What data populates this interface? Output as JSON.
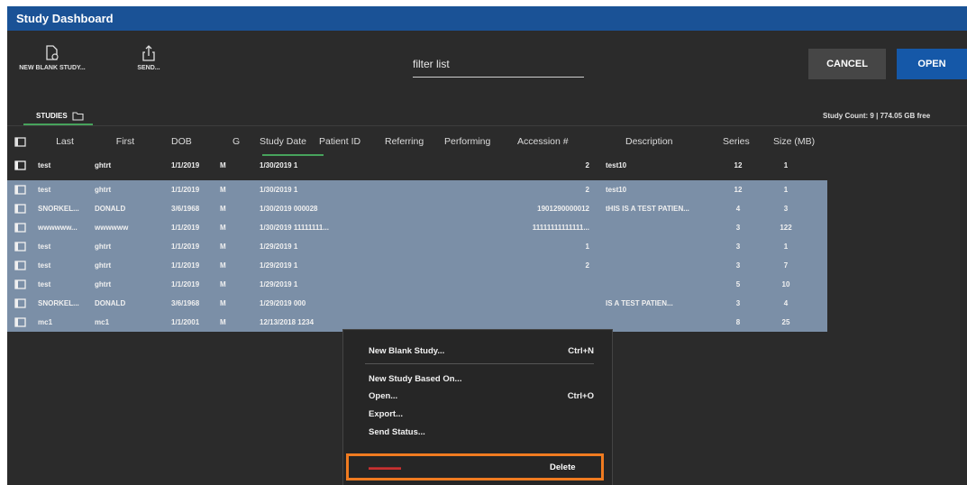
{
  "window": {
    "title": "Study Dashboard"
  },
  "toolbar": {
    "new_blank_study": {
      "label": "NEW BLANK STUDY...",
      "icon": "new-study-icon"
    },
    "send": {
      "label": "SEND...",
      "icon": "share-icon"
    },
    "filter_placeholder": "filter list",
    "cancel_label": "CANCEL",
    "open_label": "OPEN"
  },
  "tabs": {
    "studies_label": "STUDIES"
  },
  "status": {
    "study_count": "Study Count: 9 | 774.05 GB free"
  },
  "table": {
    "columns": [
      "Last",
      "First",
      "DOB",
      "G",
      "Study Date",
      "Patient ID",
      "Referring",
      "Performing",
      "Accession #",
      "Description",
      "Series",
      "Size (MB)"
    ],
    "rows": [
      {
        "last": "test",
        "first": "ghtrt",
        "dob": "1/1/2019",
        "g": "M",
        "date_pid": "1/30/2019  1",
        "acc": "2",
        "desc": "test10",
        "series": "12",
        "size": "1",
        "selected": false
      },
      {
        "last": "test",
        "first": "ghtrt",
        "dob": "1/1/2019",
        "g": "M",
        "date_pid": "1/30/2019  1",
        "acc": "2",
        "desc": "test10",
        "series": "12",
        "size": "1",
        "selected": true
      },
      {
        "last": "SNORKEL...",
        "first": "DONALD",
        "dob": "3/6/1968",
        "g": "M",
        "date_pid": "1/30/2019  000028",
        "acc": "1901290000012",
        "desc": "tHIS IS A TEST PATIEN...",
        "series": "4",
        "size": "3",
        "selected": true
      },
      {
        "last": "wwwwww...",
        "first": "wwwwww",
        "dob": "1/1/2019",
        "g": "M",
        "date_pid": "1/30/2019  11111111...",
        "acc": "11111111111111...",
        "desc": "",
        "series": "3",
        "size": "122",
        "selected": true
      },
      {
        "last": "test",
        "first": "ghtrt",
        "dob": "1/1/2019",
        "g": "M",
        "date_pid": "1/29/2019  1",
        "acc": "1",
        "desc": "",
        "series": "3",
        "size": "1",
        "selected": true
      },
      {
        "last": "test",
        "first": "ghtrt",
        "dob": "1/1/2019",
        "g": "M",
        "date_pid": "1/29/2019  1",
        "acc": "2",
        "desc": "",
        "series": "3",
        "size": "7",
        "selected": true
      },
      {
        "last": "test",
        "first": "ghtrt",
        "dob": "1/1/2019",
        "g": "M",
        "date_pid": "1/29/2019  1",
        "acc": "",
        "desc": "",
        "series": "5",
        "size": "10",
        "selected": true
      },
      {
        "last": "SNORKEL...",
        "first": "DONALD",
        "dob": "3/6/1968",
        "g": "M",
        "date_pid": "1/29/2019  000",
        "acc": "",
        "desc": "IS A TEST PATIEN...",
        "series": "3",
        "size": "4",
        "selected": true
      },
      {
        "last": "mc1",
        "first": "mc1",
        "dob": "1/1/2001",
        "g": "M",
        "date_pid": "12/13/2018  1234",
        "acc": "",
        "desc": "",
        "series": "8",
        "size": "25",
        "selected": true
      }
    ]
  },
  "context_menu": {
    "items": [
      {
        "label": "New Blank Study...",
        "shortcut": "Ctrl+N"
      },
      {
        "label": "New Study Based On...",
        "shortcut": ""
      },
      {
        "label": "Open...",
        "shortcut": "Ctrl+O"
      },
      {
        "label": "Export...",
        "shortcut": ""
      },
      {
        "label": "Send Status...",
        "shortcut": ""
      }
    ],
    "delete_label": "Delete",
    "highlight_color": "#f07b20"
  },
  "colors": {
    "titlebar": "#1a5296",
    "open_button": "#1558a8",
    "selection": "#7b8fa7",
    "tab_accent": "#47a35c"
  }
}
